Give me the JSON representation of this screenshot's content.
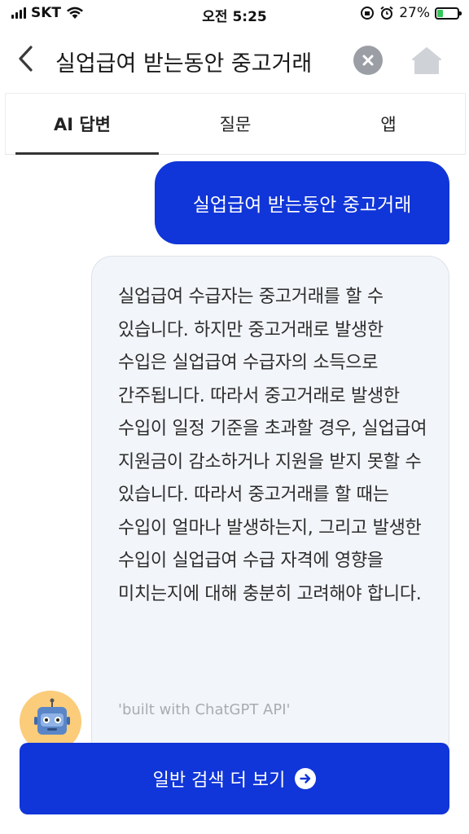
{
  "status_bar": {
    "carrier": "SKT",
    "time": "오전 5:25",
    "battery": "27%",
    "battery_level": 0.27
  },
  "search": {
    "query": "실업급여 받는동안 중고거래",
    "back_icon": "chevron-left-icon",
    "clear_icon": "close-icon",
    "home_icon": "home-icon"
  },
  "tabs": [
    {
      "label": "AI 답변",
      "active": true
    },
    {
      "label": "질문",
      "active": false
    },
    {
      "label": "앱",
      "active": false
    }
  ],
  "chat": {
    "user_message": "실업급여 받는동안 중고거래",
    "ai_answer": "실업급여 수급자는 중고거래를 할 수 있습니다. 하지만 중고거래로 발생한 수입은 실업급여 수급자의 소득으로 간주됩니다. 따라서 중고거래로 발생한 수입이 일정 기준을 초과할 경우, 실업급여 지원금이 감소하거나 지원을 받지 못할 수 있습니다. 따라서 중고거래를 할 때는 수입이 얼마나 발생하는지, 그리고 발생한 수입이 실업급여 수급 자격에 영향을 미치는지에 대해 충분히 고려해야 합니다.",
    "footnote": "'built with ChatGPT API'"
  },
  "more_button": {
    "label": "일반 검색 더 보기",
    "icon": "arrow-right-circle-icon"
  },
  "colors": {
    "accent": "#1035d8",
    "bubble_bg": "#f2f5f9",
    "avatar_bg": "#fbcc7a"
  }
}
